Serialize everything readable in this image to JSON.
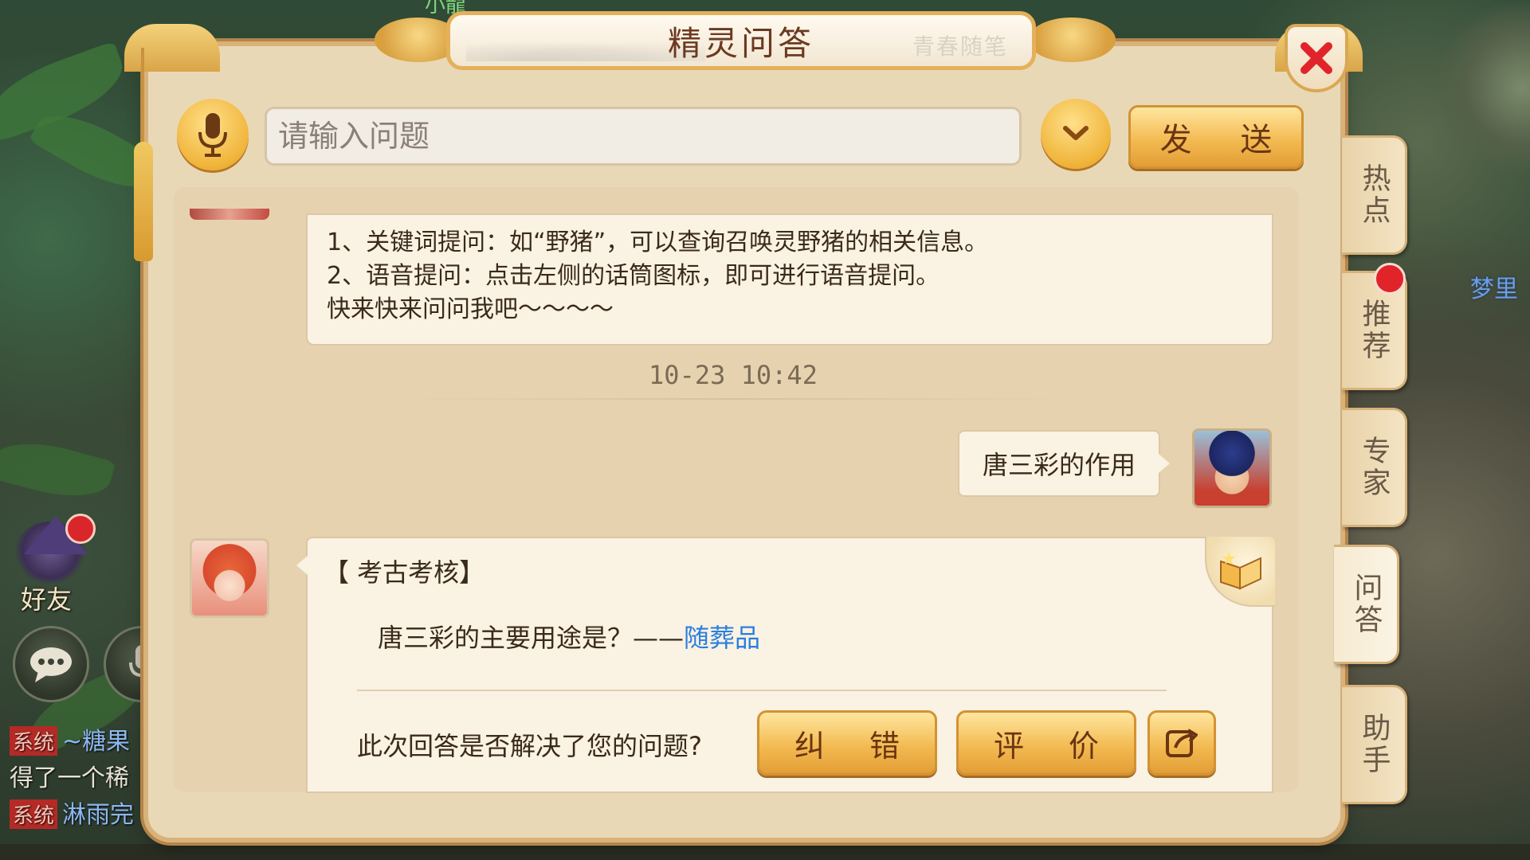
{
  "game_scene": {
    "top_name": "小龍",
    "map_label": "梦里",
    "friend_label": "好友",
    "chat_lines": [
      {
        "tag": "系统",
        "text": "~糖果"
      },
      {
        "tag": "",
        "text": "得了一个稀"
      },
      {
        "tag": "系统",
        "text": "淋雨完"
      }
    ]
  },
  "dialog": {
    "title": "精灵问答",
    "title_calligraphy": "青春随笔",
    "input": {
      "placeholder": "请输入问题",
      "value": ""
    },
    "send_label": "发 送"
  },
  "chat": {
    "intro_lines": [
      "1、关键词提问：如“野猪”，可以查询召唤灵野猪的相关信息。",
      "2、语音提问：点击左侧的话筒图标，即可进行语音提问。",
      "快来快来问问我吧～～～～"
    ],
    "timestamp": "10-23 10:42",
    "user_message": "唐三彩的作用",
    "answer": {
      "category": "【 考古考核】",
      "question": "唐三彩的主要用途是？——",
      "link": "随葬品"
    },
    "feedback": {
      "prompt": "此次回答是否解决了您的问题?",
      "correct_label": "纠 错",
      "rate_label": "评 价"
    }
  },
  "side_tabs": [
    {
      "label": "热点",
      "active": false
    },
    {
      "label": "推荐",
      "active": false,
      "badge": true
    },
    {
      "label": "专家",
      "active": false
    },
    {
      "label": "问答",
      "active": true
    },
    {
      "label": "助手",
      "active": false
    }
  ],
  "colors": {
    "panel": "#e9d8b6",
    "gold_button": "#f3bb52",
    "link": "#2a7ee0",
    "close_x": "#e0242a",
    "badge": "#e0242a"
  }
}
